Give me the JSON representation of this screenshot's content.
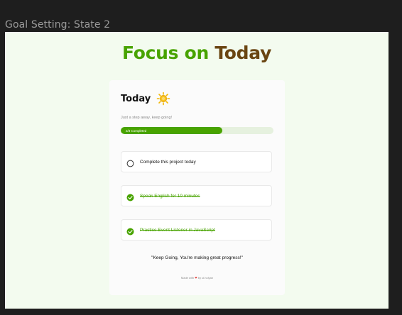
{
  "frame": {
    "label": "Goal Setting: State 2"
  },
  "header": {
    "title_part1": "Focus on",
    "title_part2": "Today"
  },
  "card": {
    "title": "Today",
    "subtitle": "Just a step away, keep going!",
    "progress": {
      "completed": 2,
      "total": 3,
      "label": "2/3 Completed"
    },
    "tasks": [
      {
        "label": "Complete this project today",
        "done": false
      },
      {
        "label": "Speak English for 10 minutes",
        "done": true
      },
      {
        "label": "Practice Event Listener in JavaScript",
        "done": true
      }
    ],
    "quote": "\"Keep Going, You're making great progress!\"",
    "footer": {
      "prefix": "Made with",
      "heart": "❤",
      "suffix": "by ui.holyan"
    }
  },
  "colors": {
    "accent_green": "#48a300",
    "title_brown": "#6a4512",
    "frame_bg": "#f3fbef",
    "card_bg": "#fbfbfb",
    "progress_track": "#e6f1df",
    "heart_red": "#e0312d"
  },
  "icons": {
    "sun": "sun-icon",
    "unchecked": "circle-outline-icon",
    "checked": "check-circle-icon"
  }
}
